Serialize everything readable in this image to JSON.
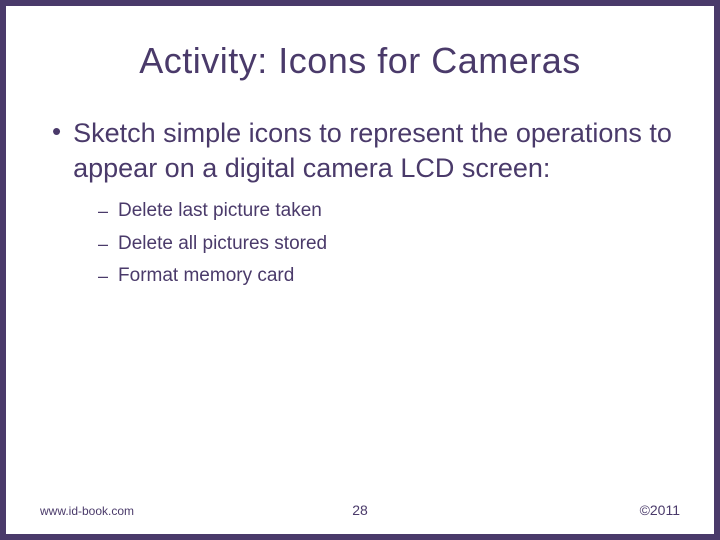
{
  "slide": {
    "title": "Activity: Icons for Cameras",
    "main_bullet": "Sketch simple icons to represent the operations to appear on a digital camera LCD screen:",
    "sub_items": [
      "Delete last picture taken",
      "Delete all pictures stored",
      "Format memory card"
    ]
  },
  "footer": {
    "url": "www.id-book.com",
    "page": "28",
    "copyright": "©2011"
  }
}
